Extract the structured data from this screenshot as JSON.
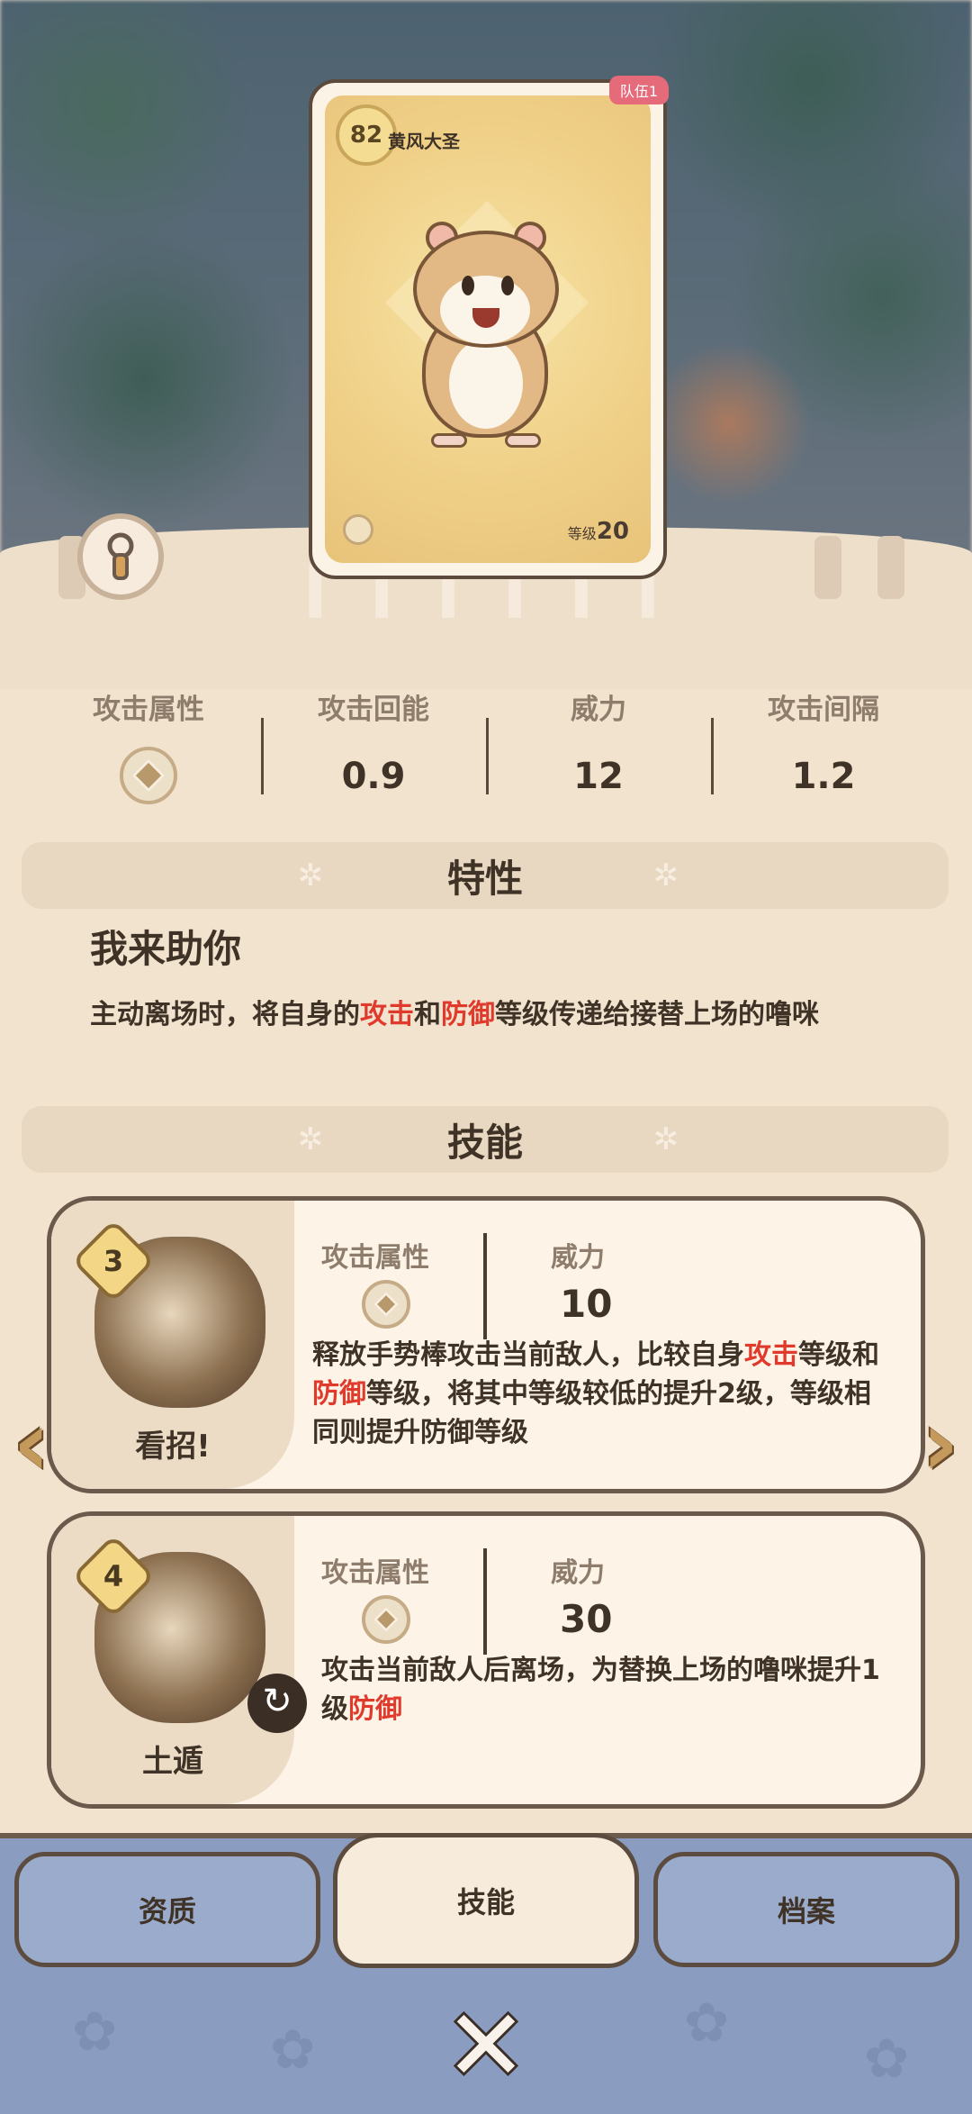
{
  "card": {
    "level_badge": "82",
    "name": "黄风大圣",
    "team_tag": "队伍1",
    "level_label": "等级",
    "level_value": "20"
  },
  "stats": [
    {
      "label": "攻击属性",
      "value": "",
      "icon": "earth-element-icon"
    },
    {
      "label": "攻击回能",
      "value": "0.9"
    },
    {
      "label": "威力",
      "value": "12"
    },
    {
      "label": "攻击间隔",
      "value": "1.2"
    }
  ],
  "sections": {
    "trait_title": "特性",
    "skill_title": "技能"
  },
  "trait": {
    "name": "我来助你",
    "desc_part1": "主动离场时，将自身的",
    "desc_hl1": "攻击",
    "desc_part2": "和",
    "desc_hl2": "防御",
    "desc_part3": "等级传递给接替上场的噜咪"
  },
  "skills": [
    {
      "cost": "3",
      "name": "看招!",
      "attr_label": "攻击属性",
      "power_label": "威力",
      "power": "10",
      "desc_part1": "释放手势棒攻击当前敌人，比较自身",
      "desc_hl1": "攻击",
      "desc_part2": "等级和",
      "desc_hl2": "防御",
      "desc_part3": "等级，将其中等级较低的提升2级，等级相同则提升防御等级"
    },
    {
      "cost": "4",
      "name": "土遁",
      "attr_label": "攻击属性",
      "power_label": "威力",
      "power": "30",
      "desc_part1": "攻击当前敌人后离场，为替换上场的噜咪提升1级",
      "desc_hl1": "防御"
    }
  ],
  "tabs": {
    "left": "资质",
    "center": "技能",
    "right": "档案"
  },
  "colors": {
    "highlight": "#e03a2c",
    "panel": "#f2e3cf",
    "tab_bar": "#8a9cbf"
  }
}
